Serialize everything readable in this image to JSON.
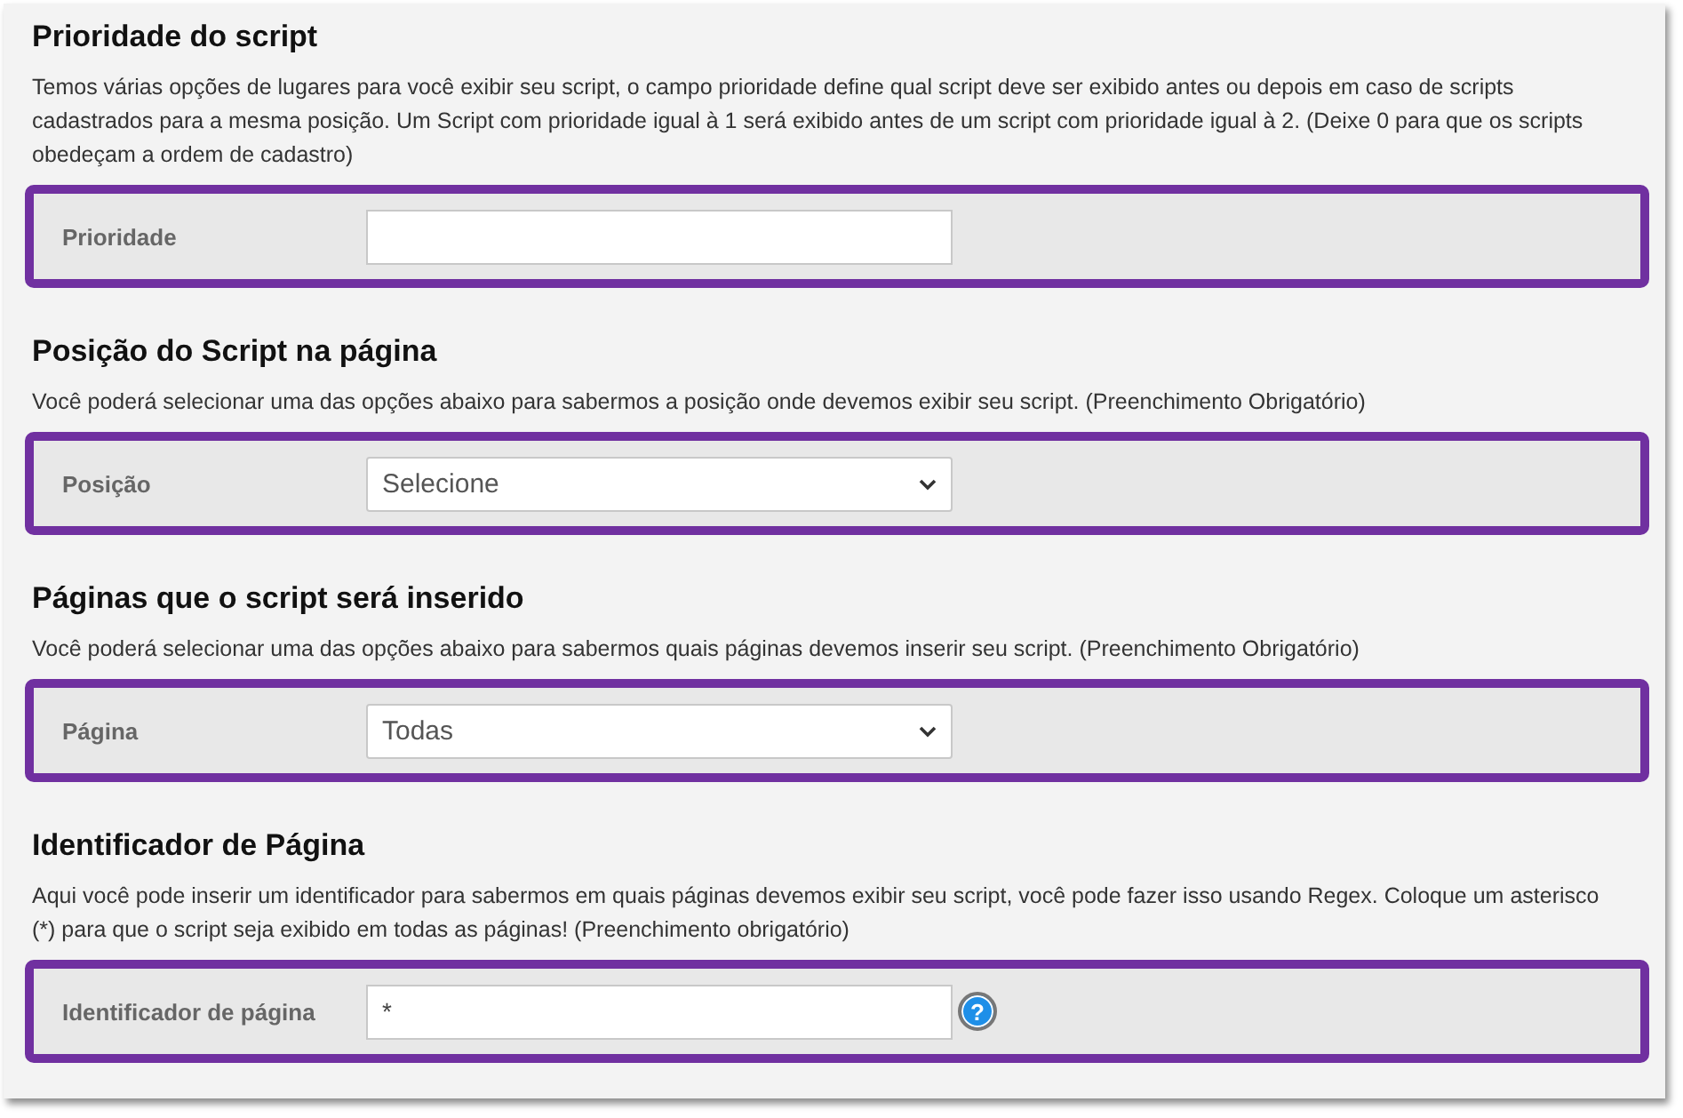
{
  "sections": [
    {
      "title": "Prioridade do script",
      "description": "Temos várias opções de lugares para você exibir seu script, o campo prioridade define qual script deve ser exibido antes ou depois em caso de scripts cadastrados para a mesma posição. Um Script com prioridade igual à 1 será exibido antes de um script com prioridade igual à 2. (Deixe 0 para que os scripts obedeçam a ordem de cadastro)",
      "field": {
        "kind": "text",
        "label": "Prioridade",
        "highlighted": true
      }
    },
    {
      "title": "Posição do Script na página",
      "description": "Você poderá selecionar uma das opções abaixo para sabermos a posição onde devemos exibir seu script. (Preenchimento Obrigatório)",
      "field": {
        "kind": "select",
        "label": "Posição",
        "value": "Selecione",
        "highlighted": true
      }
    },
    {
      "title": "Páginas que o script será inserido",
      "description": "Você poderá selecionar uma das opções abaixo para sabermos quais páginas devemos inserir seu script. (Preenchimento Obrigatório)",
      "field": {
        "kind": "select",
        "label": "Página",
        "value": "Todas",
        "highlighted": true
      }
    },
    {
      "title": "Identificador de Página",
      "description": "Aqui você pode inserir um identificador para sabermos em quais páginas devemos exibir seu script, você pode fazer isso usando Regex. Coloque um asterisco (*) para que o script seja exibido em todas as páginas! (Preenchimento obrigatório)",
      "field": {
        "kind": "text",
        "label": "Identificador de página",
        "value": "*",
        "help": "?",
        "highlighted": true
      }
    }
  ]
}
